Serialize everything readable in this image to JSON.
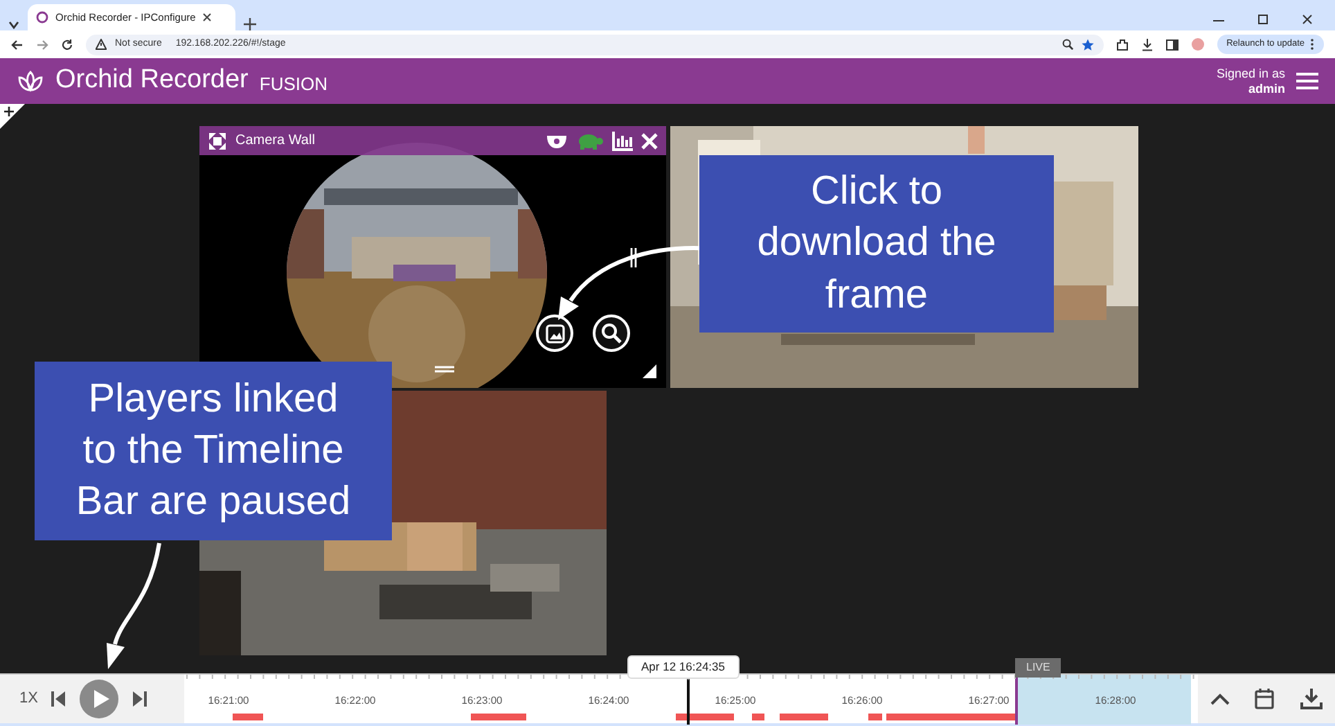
{
  "browser": {
    "tab_title": "Orchid Recorder - IPConfigure",
    "security": "Not secure",
    "url": "192.168.202.226/#!/stage",
    "update_button": "Relaunch to update"
  },
  "app": {
    "title": "Orchid Recorder",
    "edition": "FUSION",
    "signed_in_label": "Signed in as",
    "user": "admin"
  },
  "camera_wall": {
    "title": "Camera Wall"
  },
  "callouts": [
    {
      "text": "Click to download the frame"
    },
    {
      "text": "Players linked to the Timeline Bar are paused"
    }
  ],
  "timeline": {
    "speed": "1X",
    "cursor_time": "Apr 12 16:24:35",
    "live_label": "LIVE",
    "ticks": [
      "16:21:00",
      "16:22:00",
      "16:23:00",
      "16:24:00",
      "16:25:00",
      "16:26:00",
      "16:27:00",
      "16:28:00"
    ]
  }
}
